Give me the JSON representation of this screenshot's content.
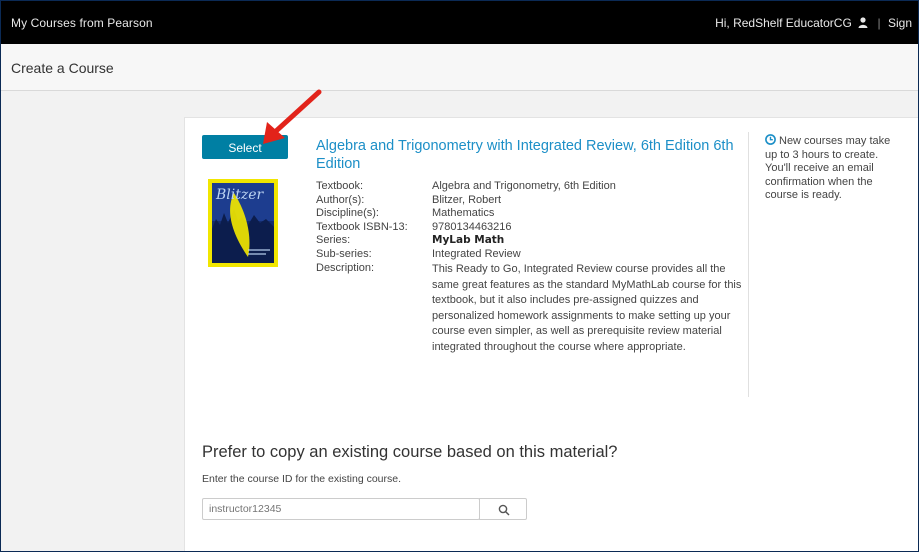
{
  "topbar": {
    "brand": "My Courses  from Pearson",
    "greeting": "Hi, RedShelf EducatorCG",
    "signout": "Sign"
  },
  "page": {
    "title": "Create a Course"
  },
  "course": {
    "select_label": "Select",
    "title": "Algebra and Trigonometry with Integrated Review, 6th Edition 6th Edition",
    "details": [
      {
        "key": "Textbook:",
        "value": "Algebra and Trigonometry, 6th Edition"
      },
      {
        "key": "Author(s):",
        "value": "Blitzer, Robert"
      },
      {
        "key": "Discipline(s):",
        "value": "Mathematics"
      },
      {
        "key": "Textbook ISBN-13:",
        "value": "9780134463216"
      },
      {
        "key": "Series:",
        "value": "MyLab Math"
      },
      {
        "key": "Sub-series:",
        "value": "Integrated Review"
      }
    ],
    "description_key": "Description:",
    "description": "This Ready to Go, Integrated Review course provides all the same great features as the standard MyMathLab course for this textbook, but it also includes pre-assigned quizzes and personalized homework assignments to make setting up your course even simpler, as well as prerequisite review material integrated throughout the course where appropriate.",
    "cover": {
      "author_word": "Blitzer",
      "bg": "#f1e600",
      "inner_bg": "#1d3d8f",
      "accent": "#f1e600"
    }
  },
  "notice": {
    "text": "New courses may take up to 3 hours to create. You'll receive an email confirmation when the course is ready."
  },
  "copy": {
    "heading": "Prefer to copy an existing course based on this material?",
    "subtext": "Enter the course ID for the existing course.",
    "placeholder": "instructor12345"
  },
  "colors": {
    "accent": "#007fa3",
    "link": "#1c8fc7",
    "annotation_arrow": "#e2231a"
  }
}
